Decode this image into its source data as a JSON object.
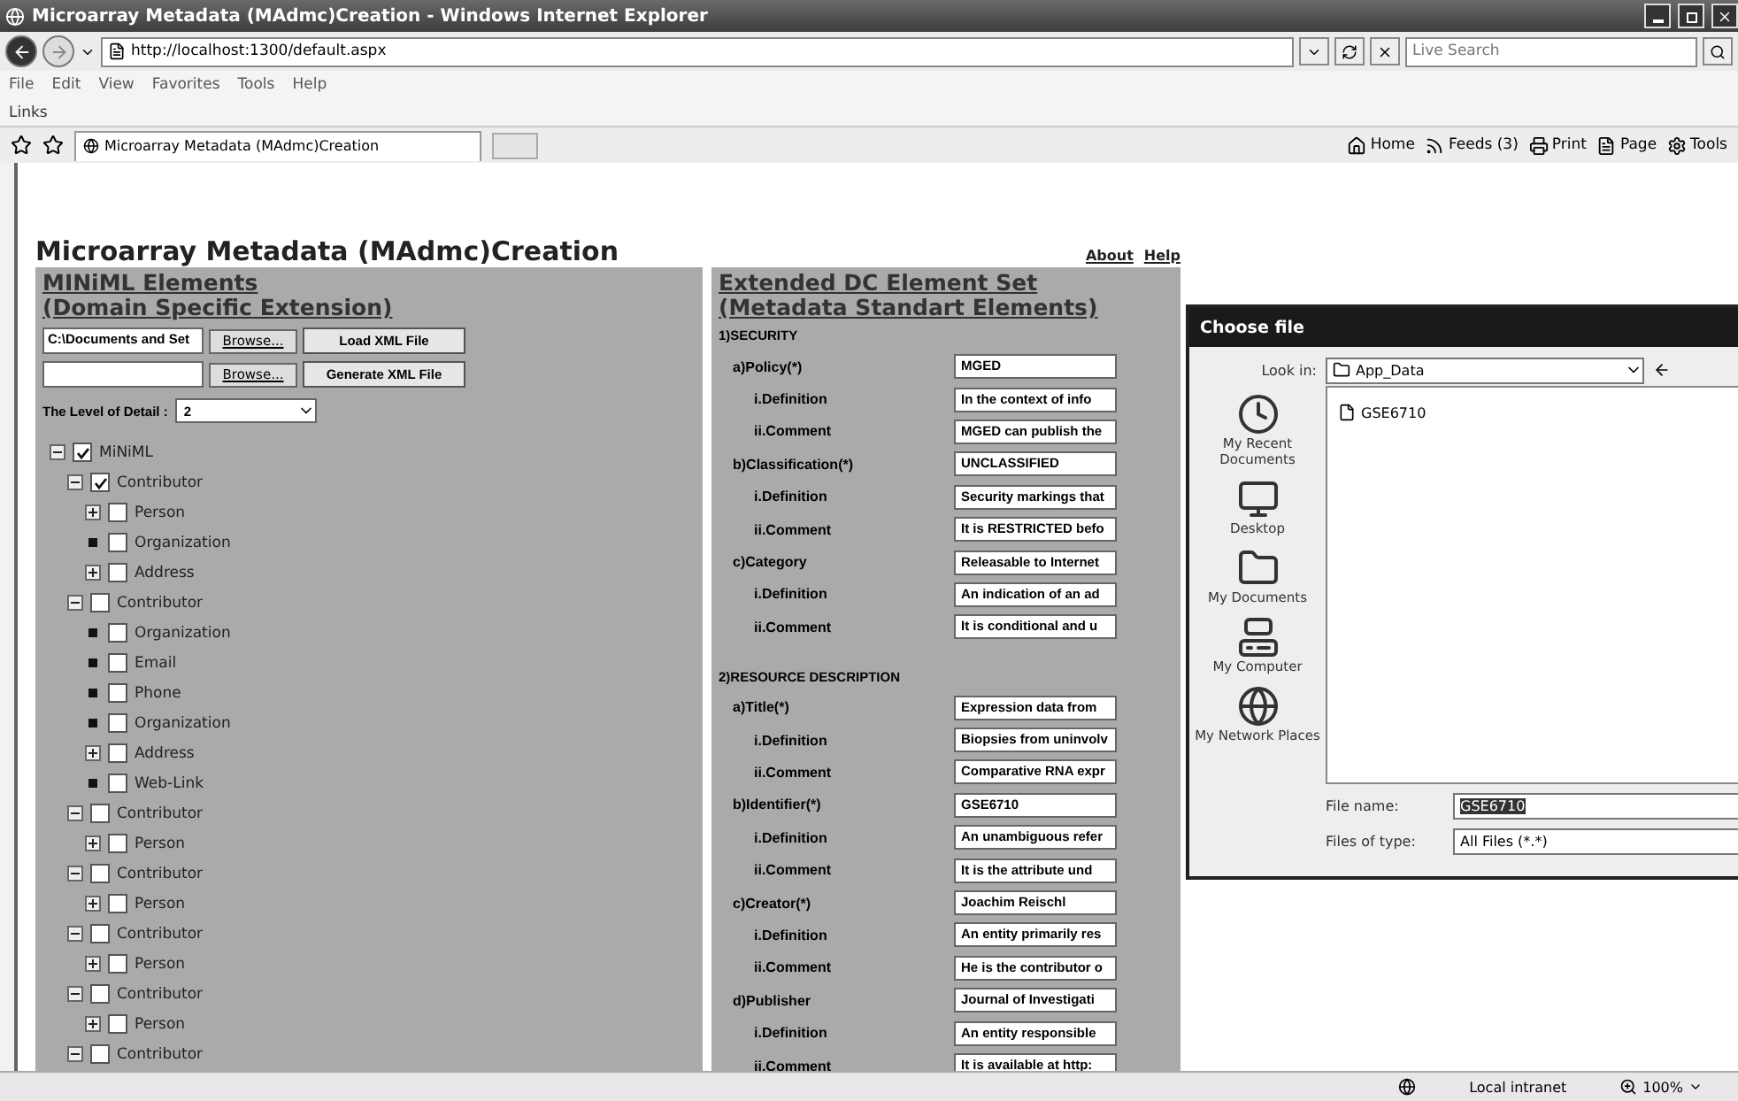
{
  "window": {
    "title": "Microarray Metadata (MAdmc)Creation - Windows Internet Explorer"
  },
  "address_bar": {
    "url": "http://localhost:1300/default.aspx"
  },
  "search": {
    "placeholder": "Live Search"
  },
  "menu": [
    "File",
    "Edit",
    "View",
    "Favorites",
    "Tools",
    "Help"
  ],
  "links_bar": {
    "label": "Links"
  },
  "tabs": [
    {
      "label": "Microarray Metadata (MAdmc)Creation",
      "selected": true
    }
  ],
  "command_bar": [
    {
      "label": "Home",
      "kind": "home"
    },
    {
      "label": "Feeds (3)",
      "kind": "feeds"
    },
    {
      "label": "Print",
      "kind": "print"
    },
    {
      "label": "Page",
      "kind": "page"
    },
    {
      "label": "Tools",
      "kind": "tools"
    }
  ],
  "page": {
    "title": "Microarray Metadata (MAdmc)Creation",
    "links": [
      "About",
      "Help"
    ],
    "miniml": {
      "heading_1": "MINiML Elements",
      "heading_2": "(Domain Specific Extension)",
      "file_rows": [
        {
          "value": "C:\\Documents and Set",
          "browse": "Browse...",
          "action": "Load XML File"
        },
        {
          "browse": "Browse...",
          "action": "Generate XML File"
        }
      ],
      "detail": {
        "label": "The Level of Detail :",
        "value": "2"
      },
      "tree": [
        {
          "label": "MiNiML",
          "checked": true,
          "expanded": true,
          "children": [
            {
              "label": "Contributor",
              "checked": true,
              "expanded": true,
              "children": [
                {
                  "label": "Person",
                  "checked": false,
                  "expanded": false
                },
                {
                  "label": "Organization",
                  "checked": false
                },
                {
                  "label": "Address",
                  "checked": false,
                  "expanded": false
                }
              ]
            },
            {
              "label": "Contributor",
              "checked": false,
              "expanded": true,
              "children": [
                {
                  "label": "Organization",
                  "checked": false
                },
                {
                  "label": "Email",
                  "checked": false
                },
                {
                  "label": "Phone",
                  "checked": false
                },
                {
                  "label": "Organization",
                  "checked": false
                },
                {
                  "label": "Address",
                  "checked": false,
                  "expanded": false
                },
                {
                  "label": "Web-Link",
                  "checked": false
                }
              ]
            },
            {
              "label": "Contributor",
              "checked": false,
              "expanded": true,
              "children": [
                {
                  "label": "Person",
                  "checked": false,
                  "expanded": false
                }
              ]
            },
            {
              "label": "Contributor",
              "checked": false,
              "expanded": true,
              "children": [
                {
                  "label": "Person",
                  "checked": false,
                  "expanded": false
                }
              ]
            },
            {
              "label": "Contributor",
              "checked": false,
              "expanded": true,
              "children": [
                {
                  "label": "Person",
                  "checked": false,
                  "expanded": false
                }
              ]
            },
            {
              "label": "Contributor",
              "checked": false,
              "expanded": true,
              "children": [
                {
                  "label": "Person",
                  "checked": false,
                  "expanded": false
                }
              ]
            },
            {
              "label": "Contributor",
              "checked": false,
              "expanded": true
            }
          ]
        }
      ]
    },
    "dc": {
      "heading_1": "Extended DC Element Set",
      "heading_2": "(Metadata Standart Elements)",
      "sections": [
        {
          "title": "1)SECURITY",
          "rows": [
            {
              "label": "a)Policy(*)",
              "value": "MGED",
              "kind": "element"
            },
            {
              "label": "i.Definition",
              "value": "In the context of info",
              "kind": "sub"
            },
            {
              "label": "ii.Comment",
              "value": "MGED can publish the",
              "kind": "sub"
            },
            {
              "label": "b)Classification(*)",
              "value": "UNCLASSIFIED",
              "kind": "element"
            },
            {
              "label": "i.Definition",
              "value": "Security markings that",
              "kind": "sub"
            },
            {
              "label": "ii.Comment",
              "value": "It is RESTRICTED befo",
              "kind": "sub"
            },
            {
              "label": "c)Category",
              "value": "Releasable to Internet",
              "kind": "element"
            },
            {
              "label": "i.Definition",
              "value": "An indication of an ad",
              "kind": "sub"
            },
            {
              "label": "ii.Comment",
              "value": "It is conditional and u",
              "kind": "sub"
            }
          ]
        },
        {
          "title": "2)RESOURCE DESCRIPTION",
          "rows": [
            {
              "label": "a)Title(*)",
              "value": "Expression data from",
              "kind": "element"
            },
            {
              "label": "i.Definition",
              "value": "Biopsies from uninvolv",
              "kind": "sub"
            },
            {
              "label": "ii.Comment",
              "value": "Comparative RNA expr",
              "kind": "sub"
            },
            {
              "label": "b)Identifier(*)",
              "value": "GSE6710",
              "kind": "element"
            },
            {
              "label": "i.Definition",
              "value": "An unambiguous refer",
              "kind": "sub"
            },
            {
              "label": "ii.Comment",
              "value": "It is the attribute und",
              "kind": "sub"
            },
            {
              "label": "c)Creator(*)",
              "value": "Joachim Reischl",
              "kind": "element"
            },
            {
              "label": "i.Definition",
              "value": "An entity primarily res",
              "kind": "sub"
            },
            {
              "label": "ii.Comment",
              "value": "He is the contributor o",
              "kind": "sub"
            },
            {
              "label": "d)Publisher",
              "value": "Journal of Investigati",
              "kind": "element"
            },
            {
              "label": "i.Definition",
              "value": "An entity responsible",
              "kind": "sub"
            },
            {
              "label": "ii.Comment",
              "value": "It is available at http:",
              "kind": "sub"
            }
          ]
        }
      ]
    }
  },
  "dialog": {
    "title": "Choose file",
    "look_in": {
      "label": "Look in:",
      "value": "App_Data"
    },
    "places": [
      {
        "label": "My Recent Documents",
        "kind": "recent"
      },
      {
        "label": "Desktop",
        "kind": "desktop"
      },
      {
        "label": "My Documents",
        "kind": "documents"
      },
      {
        "label": "My Computer",
        "kind": "computer"
      },
      {
        "label": "My Network Places",
        "kind": "network"
      }
    ],
    "files": [
      {
        "name": "GSE6710"
      }
    ],
    "file_name": {
      "label": "File name:",
      "value": "GSE6710",
      "selected": true
    },
    "file_type": {
      "label": "Files of type:",
      "value": "All Files (*.*)"
    }
  },
  "status_bar": {
    "zone": "Local intranet",
    "zoom": "100%"
  }
}
